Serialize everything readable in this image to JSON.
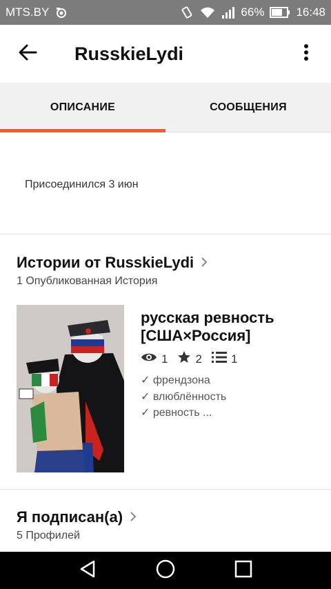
{
  "status_bar": {
    "carrier": "MTS.BY",
    "battery": "66%",
    "time": "16:48",
    "icons": [
      "camera-icon",
      "vibrate-icon",
      "wifi-icon",
      "signal-icon",
      "battery-icon"
    ]
  },
  "app_bar": {
    "title": "RusskieLydi",
    "back_icon": "arrow-left-icon",
    "more_icon": "more-vertical-icon"
  },
  "tabs": [
    {
      "label": "ОПИСАНИЕ",
      "active": true
    },
    {
      "label": "СООБЩЕНИЯ",
      "active": false
    }
  ],
  "colors": {
    "accent": "#ff5a1f",
    "status_bar": "#7c7c7c"
  },
  "profile": {
    "joined": "Присоединился 3 июн"
  },
  "stories": {
    "title": "Истории от RusskieLydi",
    "subtitle": "1 Опубликованная История",
    "items": [
      {
        "title": "русская ревность [США×Россия]",
        "stats": {
          "views": "1",
          "votes": "2",
          "parts": "1"
        },
        "tags": [
          "френдзона",
          "влюблённость",
          "ревность ..."
        ]
      }
    ]
  },
  "following": {
    "title": "Я подписан(а)",
    "subtitle": "5 Профилей"
  }
}
